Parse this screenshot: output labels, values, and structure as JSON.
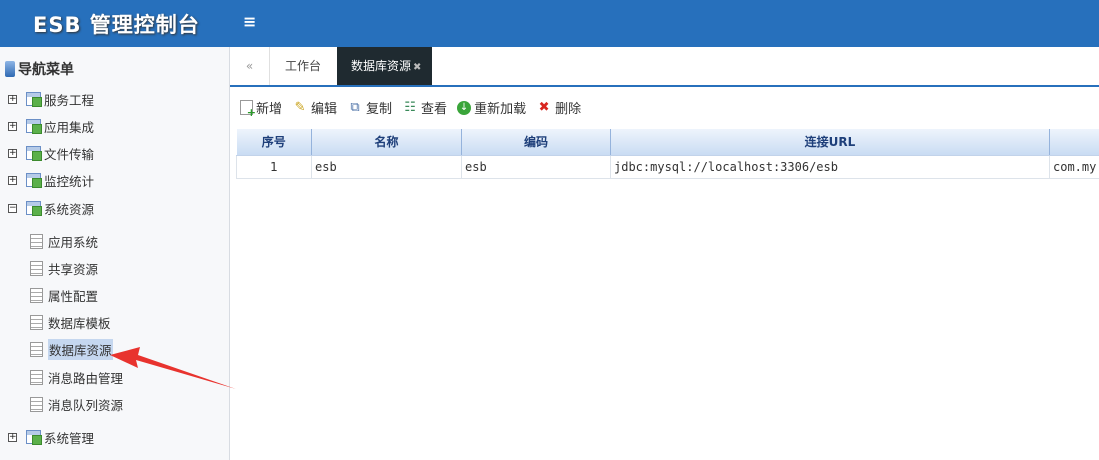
{
  "header": {
    "title": "ESB 管理控制台",
    "menu_icon": "≡"
  },
  "sidebar": {
    "title": "导航菜单",
    "items": [
      {
        "label": "服务工程",
        "expand": "+"
      },
      {
        "label": "应用集成",
        "expand": "+"
      },
      {
        "label": "文件传输",
        "expand": "+"
      },
      {
        "label": "监控统计",
        "expand": "+"
      },
      {
        "label": "系统资源",
        "expand": "−"
      },
      {
        "label": "应用系统"
      },
      {
        "label": "共享资源"
      },
      {
        "label": "属性配置"
      },
      {
        "label": "数据库模板"
      },
      {
        "label": "数据库资源"
      },
      {
        "label": "消息路由管理"
      },
      {
        "label": "消息队列资源"
      },
      {
        "label": "系统管理",
        "expand": "+"
      }
    ]
  },
  "tabs": {
    "back_icon": "«",
    "items": [
      {
        "label": "工作台"
      },
      {
        "label": "数据库资源",
        "close": "✖"
      }
    ]
  },
  "toolbar": {
    "add": "新增",
    "edit": "编辑",
    "copy": "复制",
    "view": "查看",
    "reload": "重新加载",
    "delete": "删除"
  },
  "table": {
    "columns": [
      "序号",
      "名称",
      "编码",
      "连接URL",
      ""
    ],
    "rows": [
      [
        "1",
        "esb",
        "esb",
        "jdbc:mysql://localhost:3306/esb",
        "com.my"
      ]
    ]
  },
  "colors": {
    "header": "#2770bc",
    "active_tab": "#1f2a30",
    "arrow": "#e8332e"
  }
}
